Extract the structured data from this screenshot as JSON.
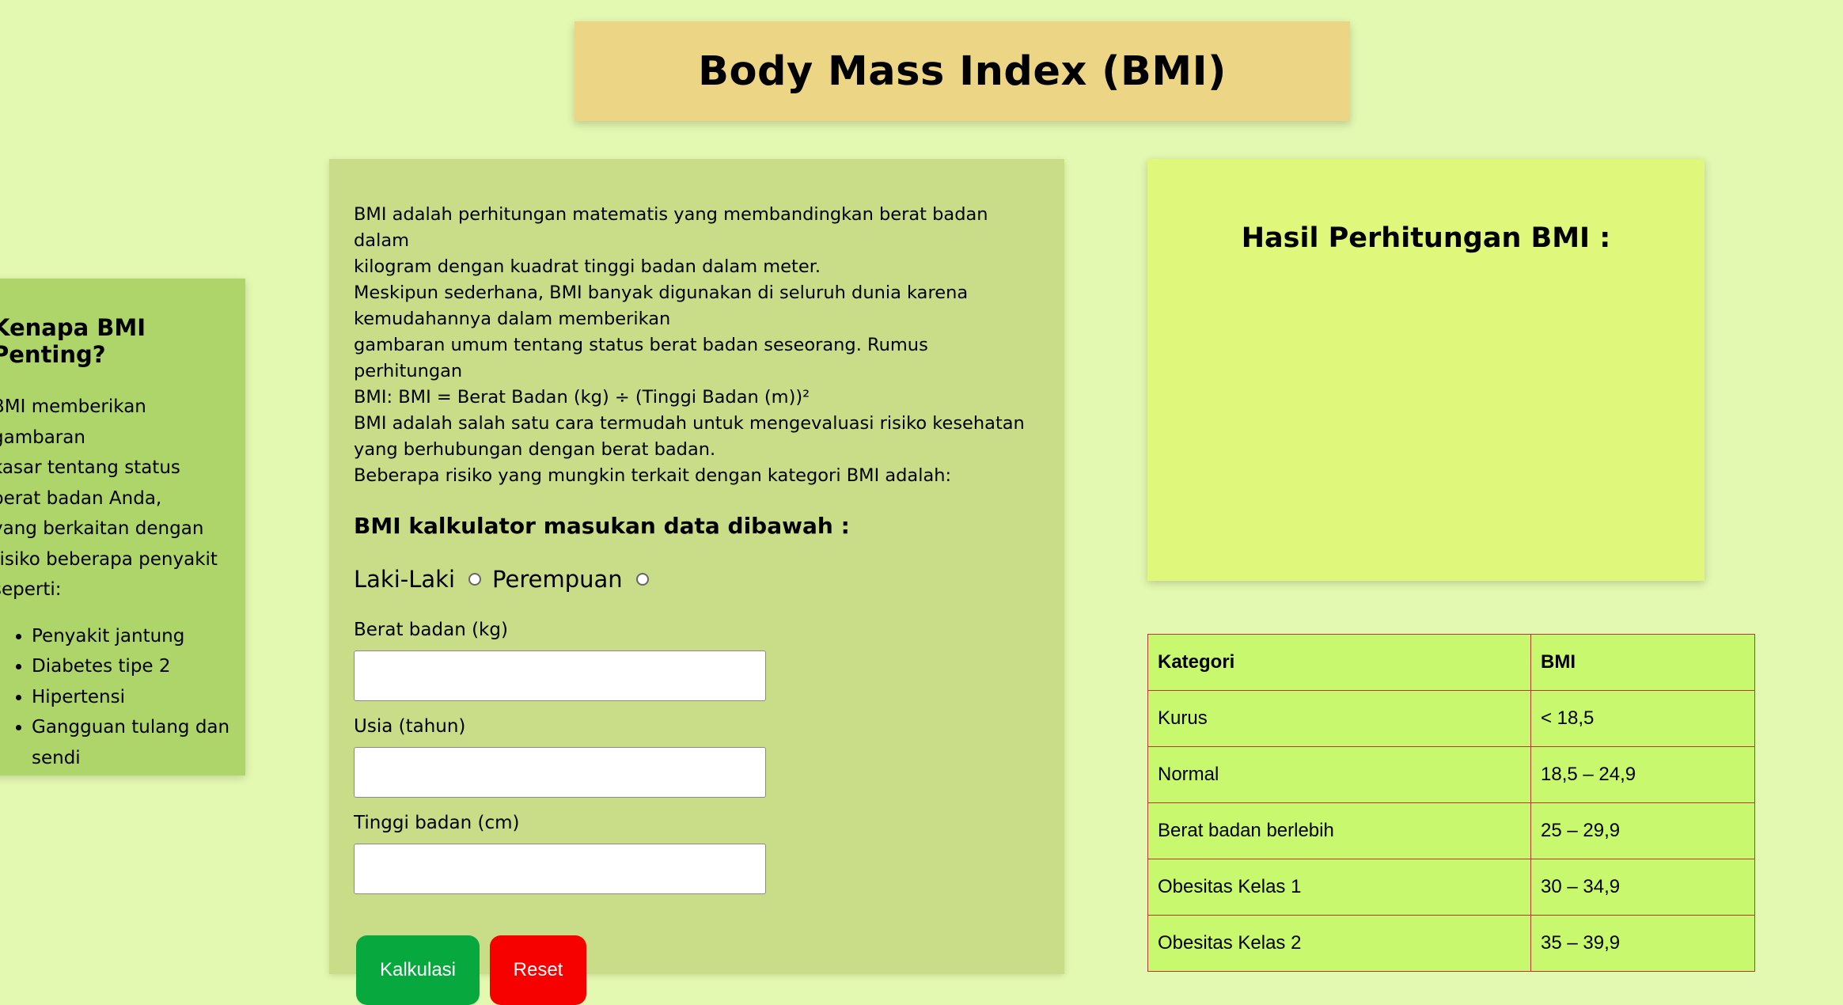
{
  "header": {
    "title": "Body Mass Index (BMI)"
  },
  "sidebar": {
    "title": "Kenapa BMI Penting?",
    "text_lines": [
      "BMI memberikan gambaran",
      "kasar tentang status",
      "berat badan Anda,",
      "yang berkaitan dengan",
      "risiko beberapa penyakit",
      "seperti:"
    ],
    "items": [
      "Penyakit jantung",
      "Diabetes tipe 2",
      "Hipertensi",
      "Gangguan tulang dan sendi"
    ]
  },
  "main": {
    "intro_lines": [
      "BMI adalah perhitungan matematis yang membandingkan berat badan dalam",
      "kilogram dengan kuadrat tinggi badan dalam meter.",
      "Meskipun sederhana, BMI banyak digunakan di seluruh dunia karena",
      "kemudahannya dalam memberikan",
      "gambaran umum tentang status berat badan seseorang. Rumus perhitungan",
      "BMI: BMI = Berat Badan (kg) ÷ (Tinggi Badan (m))²",
      "BMI adalah salah satu cara termudah untuk mengevaluasi risiko kesehatan",
      "yang berhubungan dengan berat badan.",
      "Beberapa risiko yang mungkin terkait dengan kategori BMI adalah:"
    ],
    "calc_title": "BMI kalkulator masukan data dibawah :",
    "gender_options": [
      "Laki-Laki",
      "Perempuan"
    ],
    "fields": {
      "weight": {
        "label": "Berat badan (kg)",
        "value": ""
      },
      "age": {
        "label": "Usia (tahun)",
        "value": ""
      },
      "height": {
        "label": "Tinggi badan (cm)",
        "value": ""
      }
    },
    "buttons": {
      "calculate": "Kalkulasi",
      "reset": "Reset"
    }
  },
  "result": {
    "title": "Hasil Perhitungan BMI :"
  },
  "table": {
    "headers": [
      "Kategori",
      "BMI"
    ],
    "rows": [
      [
        "Kurus",
        "< 18,5"
      ],
      [
        "Normal",
        "18,5 – 24,9"
      ],
      [
        "Berat badan berlebih",
        "25 – 29,9"
      ],
      [
        "Obesitas Kelas 1",
        "30 – 34,9"
      ],
      [
        "Obesitas Kelas 2",
        "35 – 39,9"
      ]
    ]
  }
}
